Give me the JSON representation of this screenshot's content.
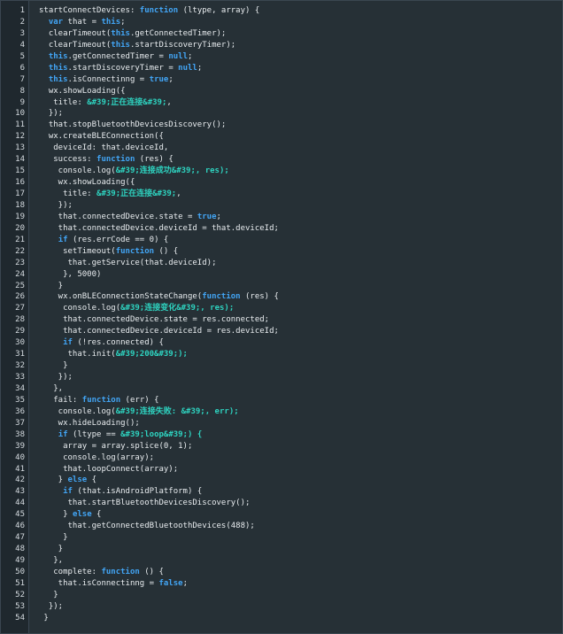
{
  "editor": {
    "colors": {
      "background": "#263036",
      "gutter": "#1f282e",
      "text": "#e8ecef",
      "keyword": "#42a5f5",
      "string": "#2ed3c0"
    },
    "lines": [
      [
        [
          "t",
          "startConnectDevices: "
        ],
        [
          "k",
          "function"
        ],
        [
          "t",
          " (ltype, array) {"
        ]
      ],
      [
        [
          "t",
          "  "
        ],
        [
          "k",
          "var"
        ],
        [
          "t",
          " that = "
        ],
        [
          "k",
          "this"
        ],
        [
          "t",
          ";"
        ]
      ],
      [
        [
          "t",
          "  clearTimeout("
        ],
        [
          "k",
          "this"
        ],
        [
          "t",
          ".getConnectedTimer);"
        ]
      ],
      [
        [
          "t",
          "  clearTimeout("
        ],
        [
          "k",
          "this"
        ],
        [
          "t",
          ".startDiscoveryTimer);"
        ]
      ],
      [
        [
          "t",
          "  "
        ],
        [
          "k",
          "this"
        ],
        [
          "t",
          ".getConnectedTimer = "
        ],
        [
          "k",
          "null"
        ],
        [
          "t",
          ";"
        ]
      ],
      [
        [
          "t",
          "  "
        ],
        [
          "k",
          "this"
        ],
        [
          "t",
          ".startDiscoveryTimer = "
        ],
        [
          "k",
          "null"
        ],
        [
          "t",
          ";"
        ]
      ],
      [
        [
          "t",
          "  "
        ],
        [
          "k",
          "this"
        ],
        [
          "t",
          ".isConnectinng = "
        ],
        [
          "k",
          "true"
        ],
        [
          "t",
          ";"
        ]
      ],
      [
        [
          "t",
          "  wx.showLoading({"
        ]
      ],
      [
        [
          "t",
          "   title: "
        ],
        [
          "s",
          "&#39;正在连接&#39;"
        ],
        [
          "t",
          ","
        ]
      ],
      [
        [
          "t",
          "  });"
        ]
      ],
      [
        [
          "t",
          "  that.stopBluetoothDevicesDiscovery();"
        ]
      ],
      [
        [
          "t",
          "  wx.createBLEConnection({"
        ]
      ],
      [
        [
          "t",
          "   deviceId: that.deviceId,"
        ]
      ],
      [
        [
          "t",
          "   success: "
        ],
        [
          "k",
          "function"
        ],
        [
          "t",
          " (res) {"
        ]
      ],
      [
        [
          "t",
          "    console.log("
        ],
        [
          "s",
          "&#39;连接成功&#39;, res);"
        ]
      ],
      [
        [
          "t",
          "    wx.showLoading({"
        ]
      ],
      [
        [
          "t",
          "     title: "
        ],
        [
          "s",
          "&#39;正在连接&#39;"
        ],
        [
          "t",
          ","
        ]
      ],
      [
        [
          "t",
          "    });"
        ]
      ],
      [
        [
          "t",
          "    that.connectedDevice.state = "
        ],
        [
          "k",
          "true"
        ],
        [
          "t",
          ";"
        ]
      ],
      [
        [
          "t",
          "    that.connectedDevice.deviceId = that.deviceId;"
        ]
      ],
      [
        [
          "t",
          "    "
        ],
        [
          "k",
          "if"
        ],
        [
          "t",
          " (res.errCode == 0) {"
        ]
      ],
      [
        [
          "t",
          "     setTimeout("
        ],
        [
          "k",
          "function"
        ],
        [
          "t",
          " () {"
        ]
      ],
      [
        [
          "t",
          "      that.getService(that.deviceId);"
        ]
      ],
      [
        [
          "t",
          "     }, 5000)"
        ]
      ],
      [
        [
          "t",
          "    }"
        ]
      ],
      [
        [
          "t",
          "    wx.onBLEConnectionStateChange("
        ],
        [
          "k",
          "function"
        ],
        [
          "t",
          " (res) {"
        ]
      ],
      [
        [
          "t",
          "     console.log("
        ],
        [
          "s",
          "&#39;连接变化&#39;, res);"
        ]
      ],
      [
        [
          "t",
          "     that.connectedDevice.state = res.connected;"
        ]
      ],
      [
        [
          "t",
          "     that.connectedDevice.deviceId = res.deviceId;"
        ]
      ],
      [
        [
          "t",
          "     "
        ],
        [
          "k",
          "if"
        ],
        [
          "t",
          " (!res.connected) {"
        ]
      ],
      [
        [
          "t",
          "      that.init("
        ],
        [
          "s",
          "&#39;200&#39;);"
        ]
      ],
      [
        [
          "t",
          "     }"
        ]
      ],
      [
        [
          "t",
          "    });"
        ]
      ],
      [
        [
          "t",
          "   },"
        ]
      ],
      [
        [
          "t",
          "   fail: "
        ],
        [
          "k",
          "function"
        ],
        [
          "t",
          " (err) {"
        ]
      ],
      [
        [
          "t",
          "    console.log("
        ],
        [
          "s",
          "&#39;连接失败: &#39;, err);"
        ]
      ],
      [
        [
          "t",
          "    wx.hideLoading();"
        ]
      ],
      [
        [
          "t",
          "    "
        ],
        [
          "k",
          "if"
        ],
        [
          "t",
          " (ltype == "
        ],
        [
          "s",
          "&#39;loop&#39;) {"
        ]
      ],
      [
        [
          "t",
          "     array = array.splice(0, 1);"
        ]
      ],
      [
        [
          "t",
          "     console.log(array);"
        ]
      ],
      [
        [
          "t",
          "     that.loopConnect(array);"
        ]
      ],
      [
        [
          "t",
          "    } "
        ],
        [
          "k",
          "else"
        ],
        [
          "t",
          " {"
        ]
      ],
      [
        [
          "t",
          "     "
        ],
        [
          "k",
          "if"
        ],
        [
          "t",
          " (that.isAndroidPlatform) {"
        ]
      ],
      [
        [
          "t",
          "      that.startBluetoothDevicesDiscovery();"
        ]
      ],
      [
        [
          "t",
          "     } "
        ],
        [
          "k",
          "else"
        ],
        [
          "t",
          " {"
        ]
      ],
      [
        [
          "t",
          "      that.getConnectedBluetoothDevices(488);"
        ]
      ],
      [
        [
          "t",
          "     }"
        ]
      ],
      [
        [
          "t",
          "    }"
        ]
      ],
      [
        [
          "t",
          "   },"
        ]
      ],
      [
        [
          "t",
          "   complete: "
        ],
        [
          "k",
          "function"
        ],
        [
          "t",
          " () {"
        ]
      ],
      [
        [
          "t",
          "    that.isConnectinng = "
        ],
        [
          "k",
          "false"
        ],
        [
          "t",
          ";"
        ]
      ],
      [
        [
          "t",
          "   }"
        ]
      ],
      [
        [
          "t",
          "  });"
        ]
      ],
      [
        [
          "t",
          " }"
        ]
      ]
    ]
  }
}
